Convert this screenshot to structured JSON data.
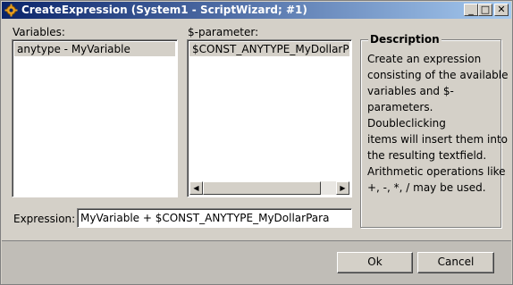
{
  "window": {
    "title": "CreateExpression (System1 - ScriptWizard; #1)",
    "title_icon": "gear-icon",
    "controls": {
      "minimize": "_",
      "maximize": "□",
      "close": "✕"
    }
  },
  "variables": {
    "label": "Variables:",
    "items": [
      "anytype - MyVariable"
    ],
    "selected": 0
  },
  "dollar_params": {
    "label": "$-parameter:",
    "items": [
      "$CONST_ANYTYPE_MyDollarPara"
    ],
    "selected": 0,
    "scroll_left": "◀",
    "scroll_right": "▶"
  },
  "description": {
    "legend": "Description",
    "lines": [
      "Create an expression",
      "consisting of the available",
      "variables and $-",
      "parameters.",
      "Doubleclicking",
      "items will insert them into",
      "the resulting textfield.",
      " Arithmetic operations like",
      "+, -, *, / may be used."
    ]
  },
  "expression": {
    "label": "Expression:",
    "value": "MyVariable + $CONST_ANYTYPE_MyDollarPara"
  },
  "buttons": {
    "ok": "Ok",
    "cancel": "Cancel"
  },
  "colors": {
    "titlebar_start": "#0a246a",
    "titlebar_end": "#a6caf0",
    "face": "#d4d0c8",
    "selection": "#d4d0c8"
  }
}
